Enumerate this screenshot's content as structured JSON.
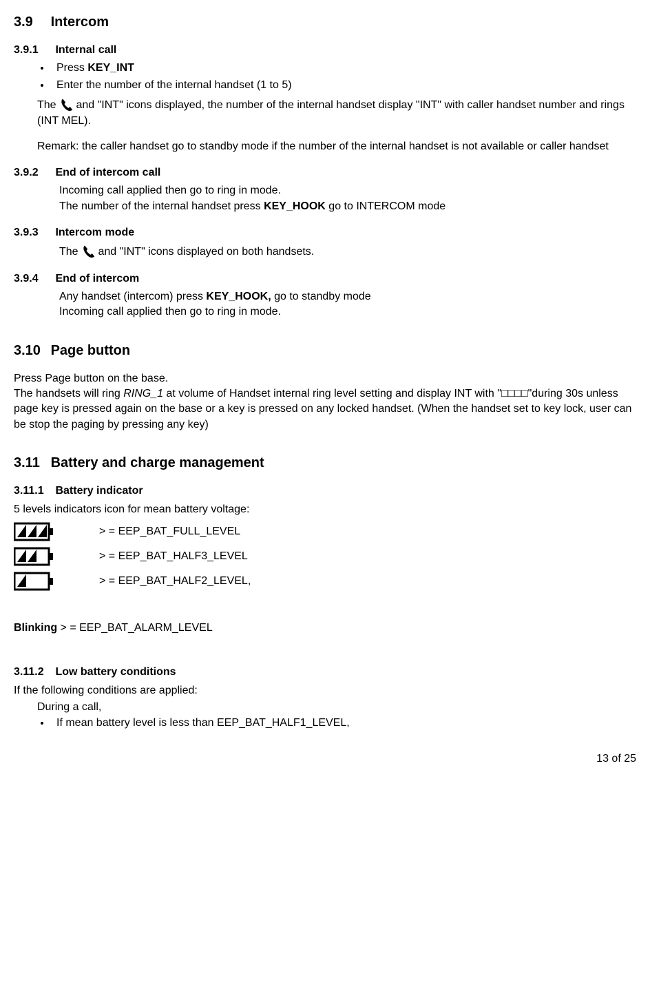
{
  "s39": {
    "num": "3.9",
    "title": "Intercom",
    "s1": {
      "num": "3.9.1",
      "title": "Internal call",
      "b1_pre": "Press ",
      "b1_bold": "KEY_INT",
      "b2": "Enter the number of the internal handset (1 to 5)",
      "p1a": "The ",
      "p1b": " and \"INT\" icons displayed,  the number of the internal handset display \"INT\" with caller handset number and rings (INT MEL).",
      "p2": "Remark: the caller handset go to standby mode if the number of the internal handset is not available or caller handset"
    },
    "s2": {
      "num": "3.9.2",
      "title": "End of intercom call",
      "p1": "Incoming call applied then go to ring in mode.",
      "p2a": "The number of the internal handset press  ",
      "p2b": "KEY_HOOK",
      "p2c": " go to INTERCOM mode"
    },
    "s3": {
      "num": "3.9.3",
      "title": "Intercom mode",
      "p1a": "The ",
      "p1b": " and \"INT\" icons displayed on both handsets."
    },
    "s4": {
      "num": "3.9.4",
      "title": "End of intercom",
      "p1a": "Any handset (intercom) press ",
      "p1b": "KEY_HOOK,",
      "p1c": " go to standby mode",
      "p2": "Incoming call applied then go to ring in mode."
    }
  },
  "s310": {
    "num": "3.10",
    "title": "Page button",
    "p1": "Press Page button on the base.",
    "p2a": "The handsets will ring ",
    "p2b": "RING_1",
    "p2c": " at volume of Handset internal ring level setting and display INT with \"□□□□\"during 30s unless page key is pressed again on the base or a key is pressed on any locked handset. (When the handset set to key lock, user can be stop the paging by pressing any key)"
  },
  "s311": {
    "num": "3.11",
    "title": "Battery and charge management",
    "s1": {
      "num": "3.11.1",
      "title": "Battery indicator",
      "p1": "5 levels indicators icon for mean battery voltage:",
      "r1": ">  = EEP_BAT_FULL_LEVEL",
      "r2": " > = EEP_BAT_HALF3_LEVEL",
      "r3": " > = EEP_BAT_HALF2_LEVEL,",
      "blink_label": "Blinking",
      "blink_text": "  > = EEP_BAT_ALARM_LEVEL"
    },
    "s2": {
      "num": "3.11.2",
      "title": "Low battery conditions",
      "p1": "If the following conditions are applied:",
      "p2": "During a call,",
      "b1": "If mean battery level is less than EEP_BAT_HALF1_LEVEL,"
    }
  },
  "footer": "13 of 25"
}
